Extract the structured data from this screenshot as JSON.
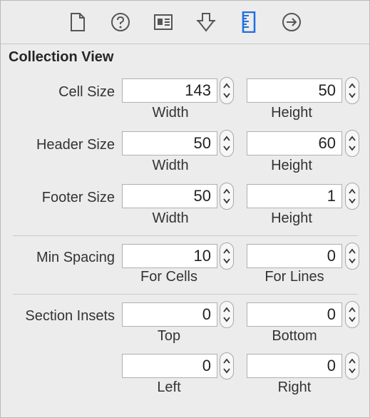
{
  "toolbar": {
    "icons": [
      "file-inspector-icon",
      "quick-help-icon",
      "identity-inspector-icon",
      "attributes-inspector-icon",
      "size-inspector-icon",
      "connections-inspector-icon"
    ],
    "active_color": "#1f6fe0"
  },
  "section": {
    "title": "Collection View"
  },
  "rows": {
    "cell_size": {
      "label": "Cell Size",
      "width": "143",
      "height": "50",
      "sub1": "Width",
      "sub2": "Height"
    },
    "header_size": {
      "label": "Header Size",
      "width": "50",
      "height": "60",
      "sub1": "Width",
      "sub2": "Height"
    },
    "footer_size": {
      "label": "Footer Size",
      "width": "50",
      "height": "1",
      "sub1": "Width",
      "sub2": "Height"
    },
    "min_spacing": {
      "label": "Min Spacing",
      "cells": "10",
      "lines": "0",
      "sub1": "For Cells",
      "sub2": "For Lines"
    },
    "section_insets": {
      "label": "Section Insets",
      "top": "0",
      "bottom": "0",
      "left": "0",
      "right": "0",
      "sub_top": "Top",
      "sub_bottom": "Bottom",
      "sub_left": "Left",
      "sub_right": "Right"
    }
  }
}
